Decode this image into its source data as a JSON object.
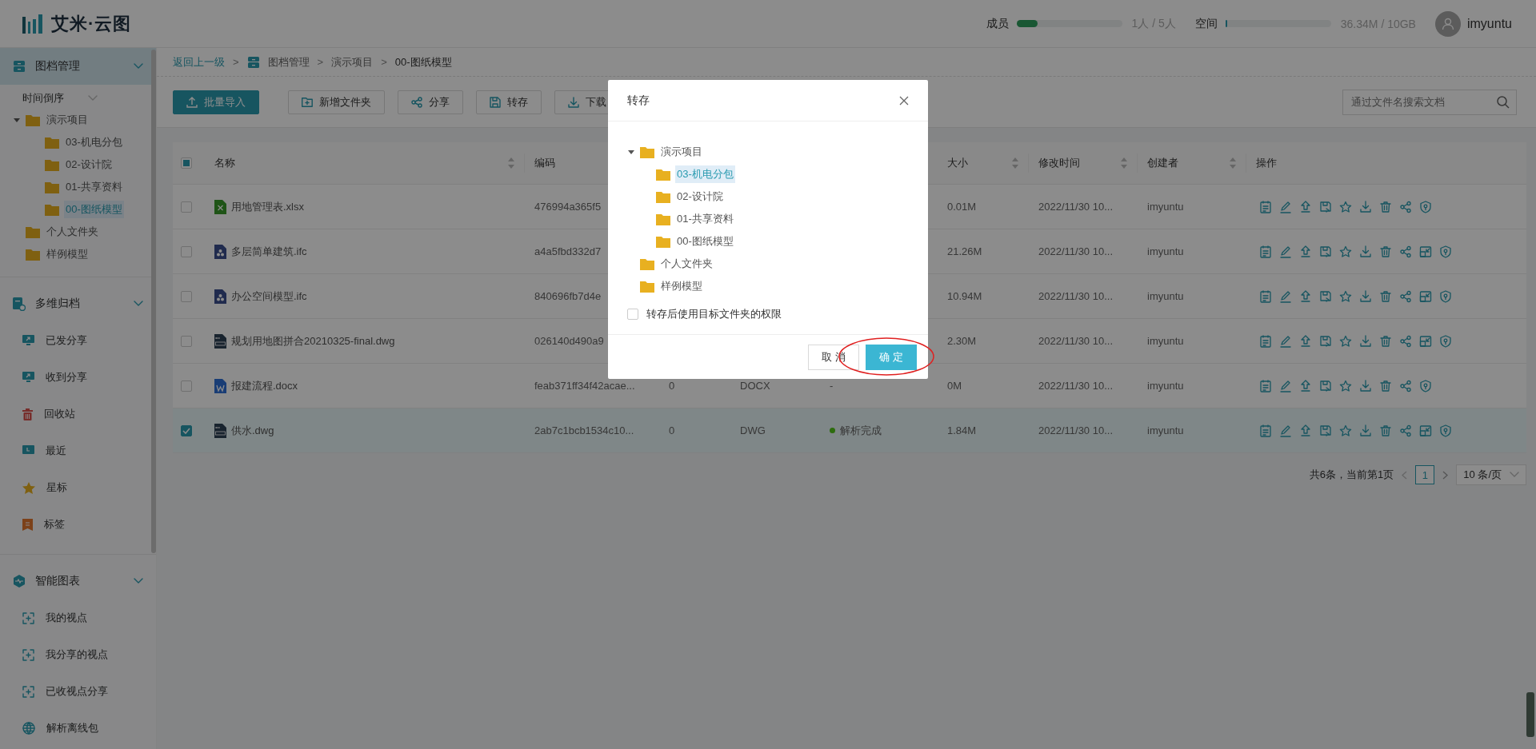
{
  "header": {
    "logo": "艾米·云图",
    "members": {
      "label": "成员",
      "level": 0.2,
      "reading": "1人 / 5人"
    },
    "storage": {
      "label": "空间",
      "level": 0.01,
      "reading": "36.34M / 10GB"
    },
    "user": "imyuntu"
  },
  "sidebar": {
    "groups": [
      {
        "title": "图档管理",
        "expanded": true,
        "selected": true,
        "sort": "时间倒序",
        "tree": [
          {
            "label": "演示项目",
            "expanded": true,
            "selected": false,
            "children": [
              {
                "label": "03-机电分包",
                "selected": false
              },
              {
                "label": "02-设计院",
                "selected": false
              },
              {
                "label": "01-共享资料",
                "selected": false
              },
              {
                "label": "00-图纸模型",
                "selected": true
              }
            ]
          },
          {
            "label": "个人文件夹",
            "selected": false
          },
          {
            "label": "样例模型",
            "selected": false
          }
        ]
      },
      {
        "title": "多维归档",
        "expanded": true,
        "selected": false,
        "items": [
          {
            "label": "已发分享"
          },
          {
            "label": "收到分享"
          },
          {
            "label": "回收站"
          },
          {
            "label": "最近"
          },
          {
            "label": "星标"
          },
          {
            "label": "标签"
          }
        ]
      },
      {
        "title": "智能图表",
        "expanded": true,
        "selected": false,
        "items": [
          {
            "label": "我的视点"
          },
          {
            "label": "我分享的视点"
          },
          {
            "label": "已收视点分享"
          },
          {
            "label": "解析离线包"
          }
        ]
      }
    ]
  },
  "breadcrumb": {
    "back": "返回上一级",
    "path": [
      {
        "separator": ">",
        "label": "图档管理"
      },
      {
        "separator": ">",
        "label": "演示项目"
      },
      {
        "separator": ">",
        "label": "00-图纸模型"
      }
    ]
  },
  "toolbar": {
    "buttons": [
      {
        "label": "批量导入",
        "primary": true
      },
      {
        "label": "新增文件夹",
        "primary": false
      },
      {
        "label": "分享",
        "primary": false
      },
      {
        "label": "转存",
        "primary": false
      },
      {
        "label": "下载",
        "primary": false
      }
    ],
    "search": {
      "placeholder": "通过文件名搜索文档"
    }
  },
  "table": {
    "select_all": {
      "indeterminate": true
    },
    "columns": [
      {
        "label": "名称",
        "sortable": true
      },
      {
        "label": "编码",
        "sortable": false
      },
      {
        "label": "大小",
        "sortable": true
      },
      {
        "label": "修改时间",
        "sortable": true
      },
      {
        "label": "创建者",
        "sortable": true
      },
      {
        "label": "操作",
        "sortable": false
      }
    ],
    "rows": [
      {
        "selected": false,
        "kind": "xlsx",
        "name": "用地管理表.xlsx",
        "code": "476994a365f5",
        "size": "0.01M",
        "modified": "2022/11/30 10...",
        "creator": "imyuntu",
        "convert": false
      },
      {
        "selected": false,
        "kind": "ifc",
        "name": "多层简单建筑.ifc",
        "code": "a4a5fbd332d7",
        "size": "21.26M",
        "modified": "2022/11/30 10...",
        "creator": "imyuntu",
        "convert": true
      },
      {
        "selected": false,
        "kind": "ifc",
        "name": "办公空间模型.ifc",
        "code": "840696fb7d4e",
        "size": "10.94M",
        "modified": "2022/11/30 10...",
        "creator": "imyuntu",
        "convert": true
      },
      {
        "selected": false,
        "kind": "dwg",
        "name": "规划用地图拼合20210325-final.dwg",
        "code": "026140d490a9",
        "size": "2.30M",
        "modified": "2022/11/30 10...",
        "creator": "imyuntu",
        "convert": true
      },
      {
        "selected": false,
        "kind": "docx",
        "name": "报建流程.docx",
        "code": "feab371ff34f42acae...",
        "column_3": "0",
        "column_4": "DOCX",
        "status": {
          "text": "-"
        },
        "size": "0M",
        "modified": "2022/11/30 10...",
        "creator": "imyuntu",
        "convert": false
      },
      {
        "selected": true,
        "kind": "dwg",
        "name": "供水.dwg",
        "code": "2ab7c1bcb1534c10...",
        "column_3": "0",
        "column_4": "DWG",
        "status": {
          "text": "解析完成",
          "color": "#2d6c0e"
        },
        "size": "1.84M",
        "modified": "2022/11/30 10...",
        "creator": "imyuntu",
        "convert": true
      }
    ]
  },
  "pagination": {
    "summary": "共6条，当前第1页",
    "pages": [
      {
        "label": "1",
        "selected": true
      }
    ],
    "page_size": "10 条/页"
  },
  "dialog": {
    "title": "转存",
    "tree": [
      {
        "label": "演示项目",
        "expanded": true,
        "selected": false,
        "children": [
          {
            "label": "03-机电分包",
            "selected": true
          },
          {
            "label": "02-设计院",
            "selected": false
          },
          {
            "label": "01-共享资料",
            "selected": false
          },
          {
            "label": "00-图纸模型",
            "selected": false
          }
        ]
      },
      {
        "label": "个人文件夹",
        "selected": false
      },
      {
        "label": "样例模型",
        "selected": false
      }
    ],
    "option": {
      "label": "转存后使用目标文件夹的权限",
      "checked": false
    },
    "cancel": "取 消",
    "confirm": "确 定",
    "highlight_confirm": true
  }
}
